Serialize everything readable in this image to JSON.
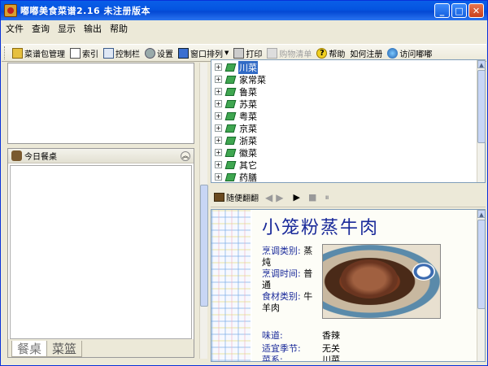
{
  "window": {
    "title": "嘟嘟美食菜谱2.16   未注册版本",
    "controls": {
      "minimize": "_",
      "maximize": "□",
      "close": "✕"
    }
  },
  "menu": [
    "文件",
    "查询",
    "显示",
    "输出",
    "帮助"
  ],
  "toolbar": [
    {
      "label": "菜谱包管理",
      "icon": "book-icon",
      "enabled": true
    },
    {
      "label": "索引",
      "icon": "index-icon",
      "enabled": true
    },
    {
      "label": "控制栏",
      "icon": "control-icon",
      "enabled": true
    },
    {
      "label": "设置",
      "icon": "settings-icon",
      "enabled": true
    },
    {
      "label": "窗口排列",
      "icon": "window-icon",
      "enabled": true
    },
    {
      "label": "打印",
      "icon": "printer-icon",
      "enabled": true
    },
    {
      "label": "购物清单",
      "icon": "cart-icon",
      "enabled": false
    },
    {
      "label": "帮助",
      "icon": "help-icon",
      "enabled": true
    },
    {
      "label": "如何注册",
      "icon": "",
      "enabled": true
    },
    {
      "label": "访问嘟嘟",
      "icon": "globe-icon",
      "enabled": true
    }
  ],
  "today_panel": {
    "title": "今日餐桌",
    "tabs": [
      "餐桌",
      "菜篮"
    ]
  },
  "tree": {
    "items": [
      "川菜",
      "家常菜",
      "鲁菜",
      "苏菜",
      "粤菜",
      "京菜",
      "浙菜",
      "徽菜",
      "其它",
      "药膳"
    ],
    "selected": "川菜"
  },
  "player": {
    "flip_label": "随便翻翻",
    "prev": "◀",
    "next": "▶",
    "play": "▶",
    "stop": "■",
    "pause": "⏸"
  },
  "recipe": {
    "title": "小笼粉蒸牛肉",
    "fields": {
      "cooking_class_label": "烹调类别:",
      "cooking_class_value": "蒸炖",
      "cooking_time_label": "烹调时间:",
      "cooking_time_value": "普通",
      "ingredient_class_label": "食材类别:",
      "ingredient_class_value": "牛羊肉",
      "taste_label": "味道:",
      "taste_value": "香辣",
      "season_label": "适宜季节:",
      "season_value": "无关",
      "cuisine_label": "菜系:",
      "cuisine_value": "川菜"
    }
  }
}
